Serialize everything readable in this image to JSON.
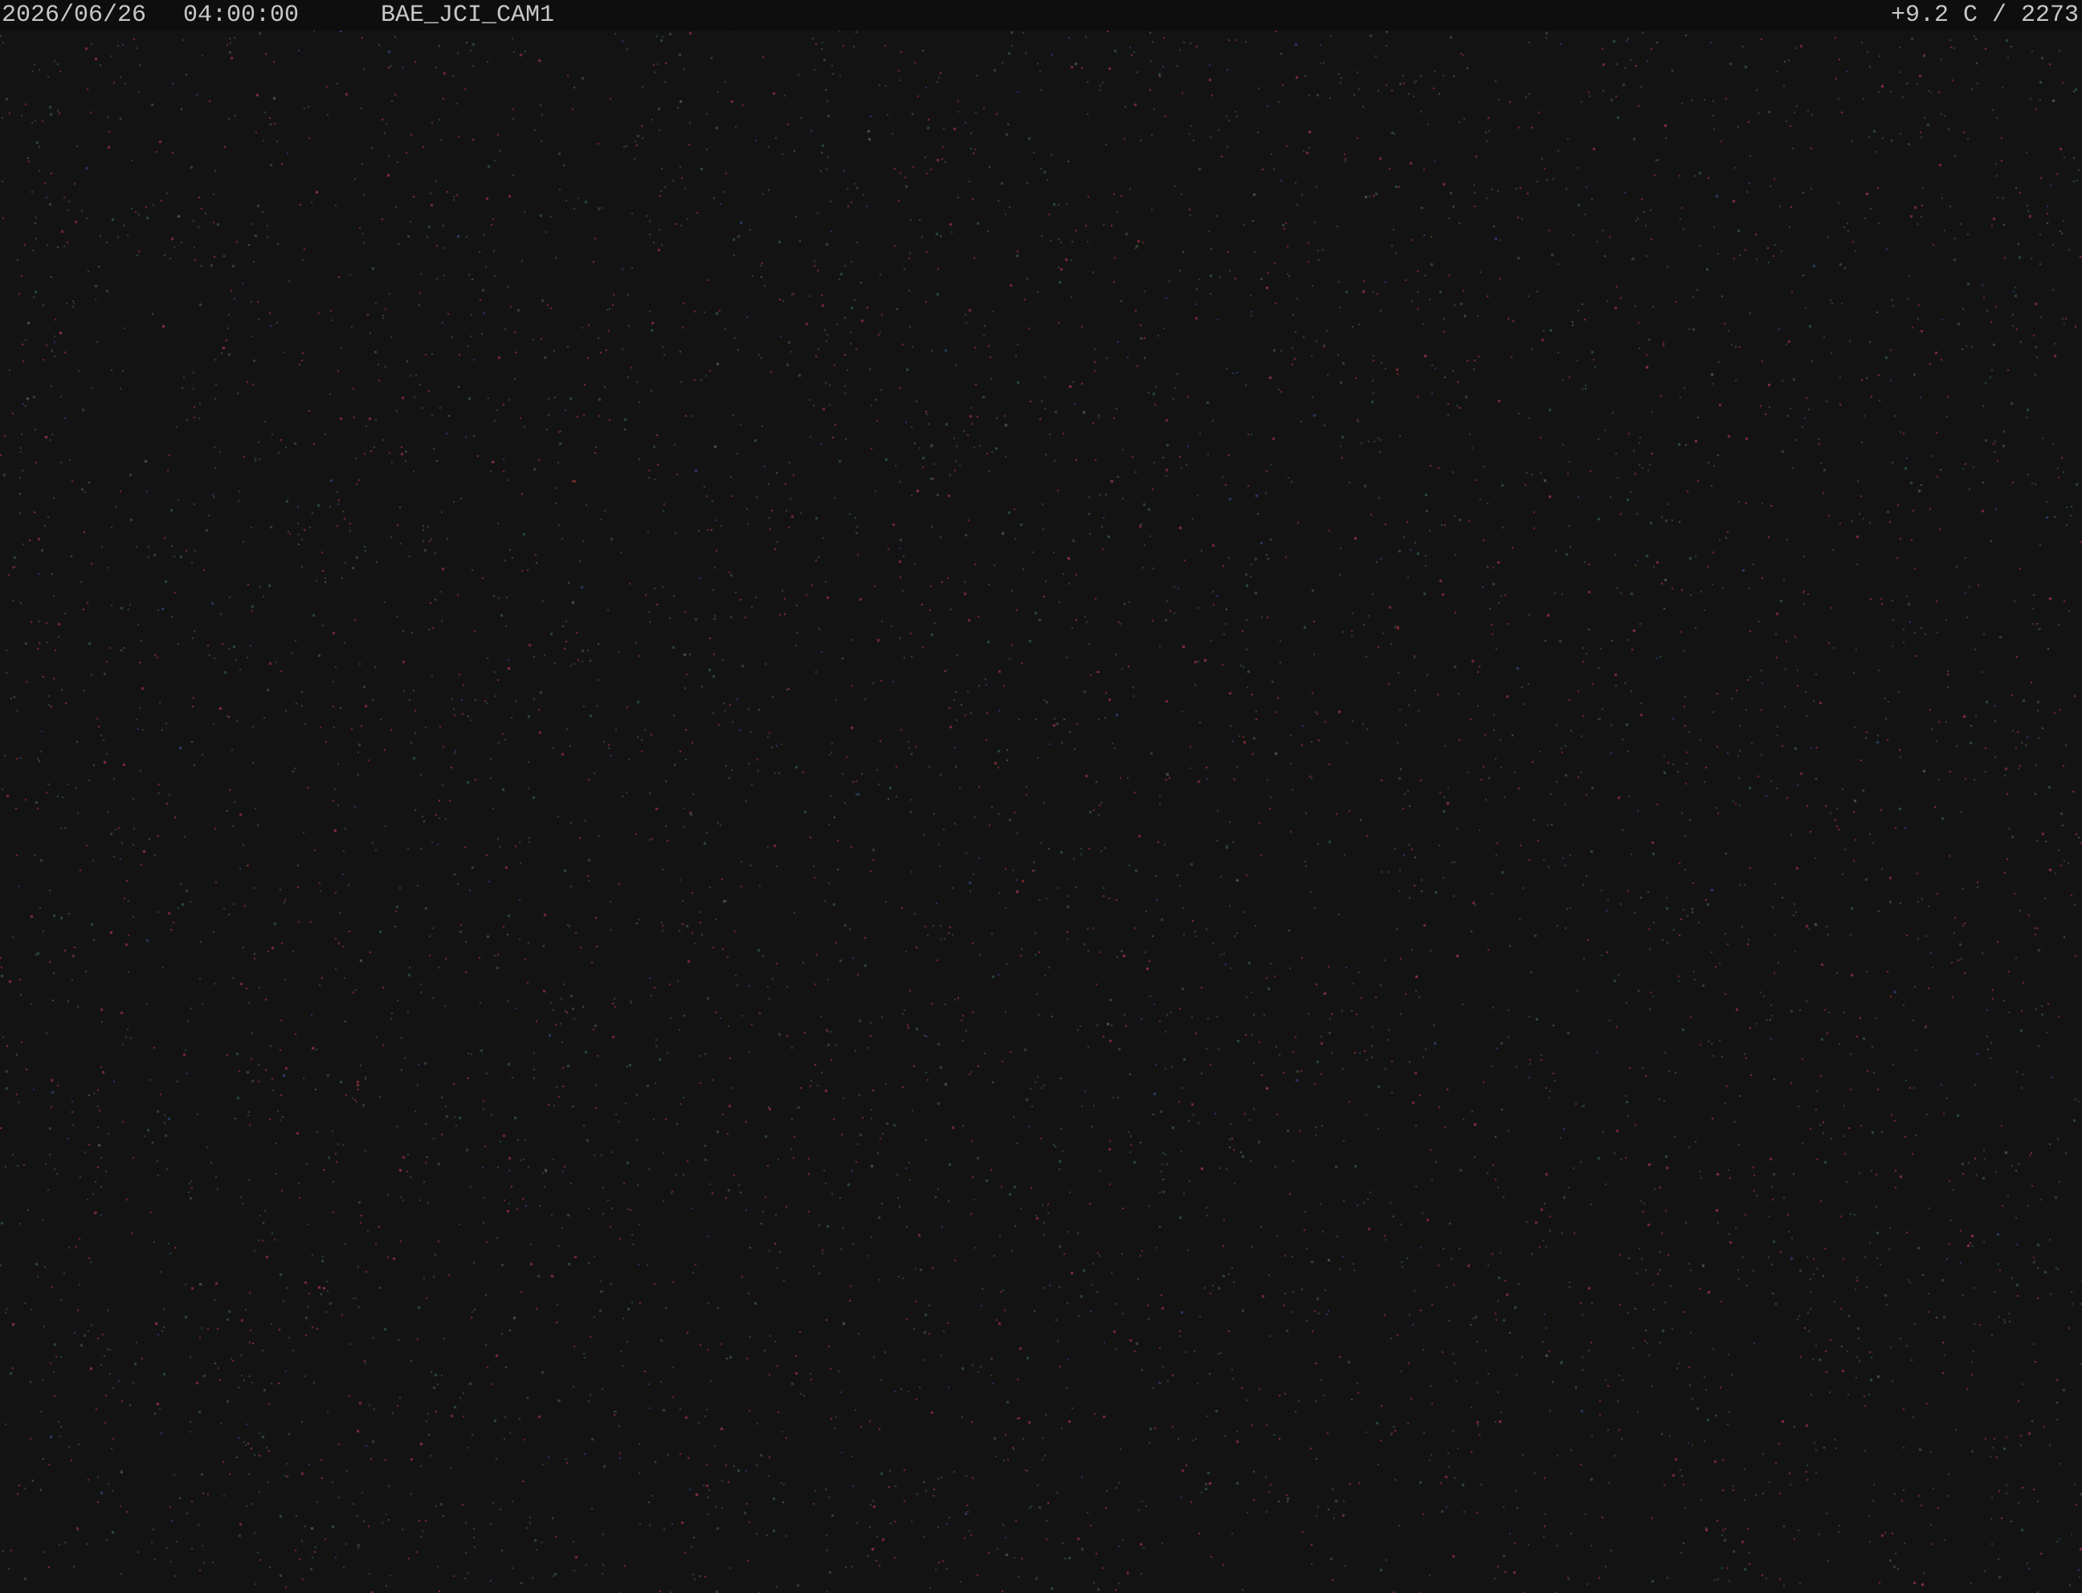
{
  "overlay": {
    "date": "2026/06/26",
    "time": "04:00:00",
    "camera": "BAE_JCI_CAM1",
    "stats": "+9.2 C / 2273"
  },
  "image": {
    "background_color": "#131313",
    "noise_colors": [
      "#7a2a34",
      "#8a3040",
      "#2e4a3a",
      "#34403a",
      "#2a3a6a",
      "#505050"
    ]
  }
}
